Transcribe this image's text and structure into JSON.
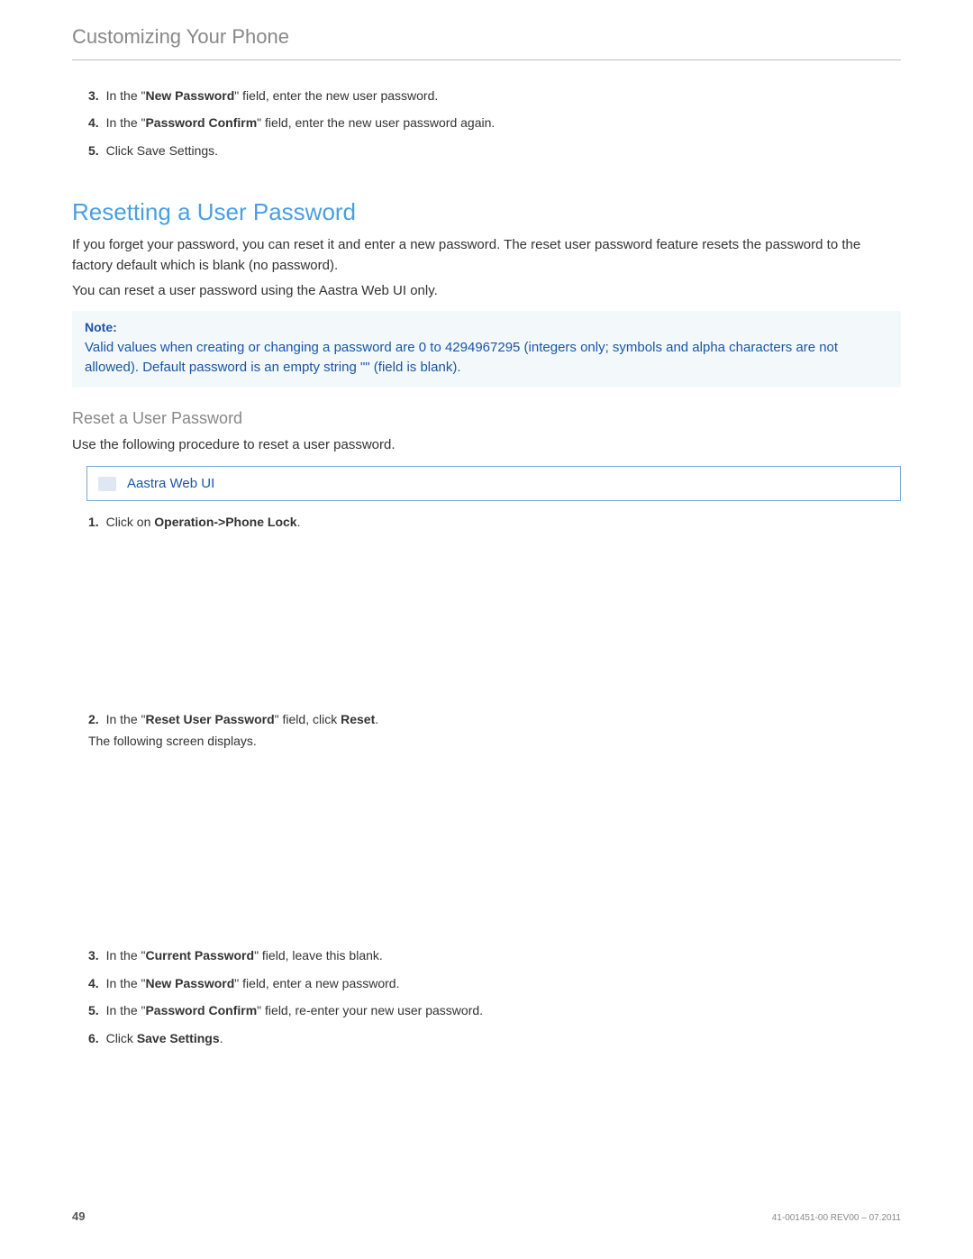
{
  "header": {
    "title": "Customizing Your Phone"
  },
  "intro_steps": [
    {
      "num": "3.",
      "pre": "In the \"",
      "bold": "New Password",
      "post": "\" field, enter the new user password."
    },
    {
      "num": "4.",
      "pre": "In the \"",
      "bold": "Password Confirm",
      "post": "\" field, enter the new user password again."
    },
    {
      "num": "5.",
      "pre": "",
      "bold": "",
      "post": "Click Save Settings."
    }
  ],
  "section1": {
    "heading": "Resetting a User Password",
    "para1": "If you forget your password, you can reset it and enter a new password. The reset user password feature resets the password to the factory default which is blank (no password).",
    "para2": "You can reset a user password using the Aastra Web UI only."
  },
  "note": {
    "label": "Note:",
    "text": "Valid values when creating or changing a password are 0 to 4294967295 (integers only; symbols and alpha characters are not allowed). Default password is an empty string \"\" (field is blank)."
  },
  "sub": {
    "heading": "Reset a User Password",
    "intro": "Use the following procedure to reset a user password."
  },
  "webui": {
    "label": "Aastra Web UI"
  },
  "step1": {
    "num": "1.",
    "pre": "Click on ",
    "bold": "Operation->Phone Lock",
    "post": "."
  },
  "step2": {
    "num": "2.",
    "pre": "In the \"",
    "bold1": "Reset User Password",
    "mid": "\" field, click ",
    "bold2": "Reset",
    "post": ".",
    "line2": "The following screen displays."
  },
  "tail_steps": [
    {
      "num": "3.",
      "pre": "In the \"",
      "bold": "Current Password",
      "post": "\" field, leave this blank."
    },
    {
      "num": "4.",
      "pre": "In the \"",
      "bold": "New Password",
      "post": "\" field, enter a new password."
    },
    {
      "num": "5.",
      "pre": "In the \"",
      "bold": "Password Confirm",
      "post": "\" field, re-enter your new user password."
    },
    {
      "num": "6.",
      "pre": "Click ",
      "bold": "Save Settings",
      "post": "."
    }
  ],
  "footer": {
    "page": "49",
    "rev": "41-001451-00 REV00 – 07.2011"
  }
}
